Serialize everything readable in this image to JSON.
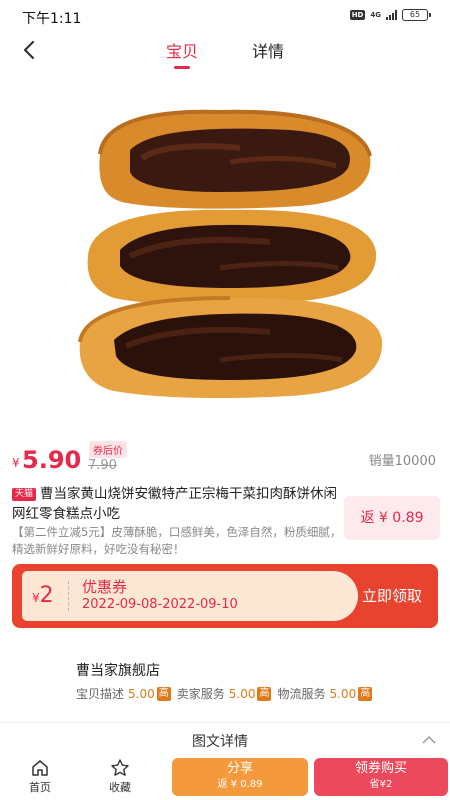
{
  "status_bar": {
    "time": "下午1:11",
    "hd": "HD",
    "network": "4G",
    "battery": "65"
  },
  "nav": {
    "tabs": [
      {
        "label": "宝贝",
        "active": true
      },
      {
        "label": "详情",
        "active": false
      }
    ],
    "accent_color": "#e6294a"
  },
  "product": {
    "image_icon": "mooncake-photo",
    "currency": "¥",
    "price": "5.90",
    "coupon_price_tag": "券后价",
    "original_price": "7.90",
    "sales": "销量10000",
    "platform_badge": "天猫",
    "title": "曹当家黄山烧饼安徽特产正宗梅干菜扣肉酥饼休闲网红零食糕点小吃",
    "rebate": "返 ¥ 0.89",
    "description": "【第二件立减5元】皮薄酥脆，口感鲜美，色泽自然，粉质细腻，精选新鲜好原料，好吃没有秘密！"
  },
  "coupon": {
    "currency": "¥",
    "amount": "2",
    "name": "优惠券",
    "dates": "2022-09-08-2022-09-10",
    "claim_label": "立即领取"
  },
  "store": {
    "name": "曹当家旗舰店",
    "ratings": [
      {
        "label": "宝贝描述",
        "score": "5.00",
        "level": "高"
      },
      {
        "label": "卖家服务",
        "score": "5.00",
        "level": "高"
      },
      {
        "label": "物流服务",
        "score": "5.00",
        "level": "高"
      }
    ]
  },
  "detail_section": {
    "title": "图文详情"
  },
  "bottom_bar": {
    "home_label": "首页",
    "favorite_label": "收藏",
    "share_label": "分享",
    "share_sub": "返 ¥ 0.89",
    "buy_label": "领券购买",
    "buy_sub": "省¥2"
  }
}
